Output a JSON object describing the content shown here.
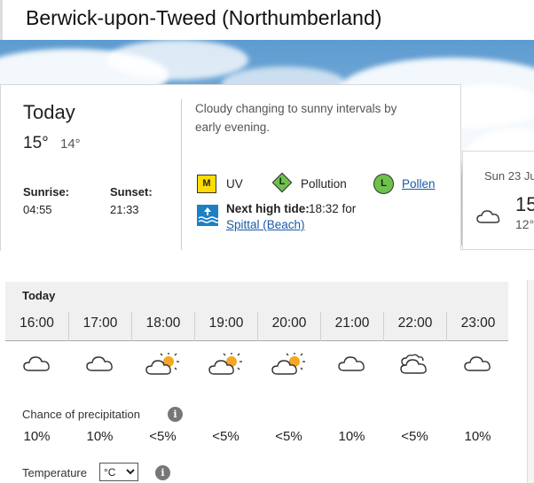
{
  "location": {
    "title": "Berwick-upon-Tweed (Northumberland)"
  },
  "today": {
    "label": "Today",
    "high": "15°",
    "low": "14°",
    "sunrise_label": "Sunrise:",
    "sunrise": "04:55",
    "sunset_label": "Sunset:",
    "sunset": "21:33",
    "summary": "Cloudy changing to sunny intervals by early evening.",
    "uv": {
      "level": "M",
      "label": "UV",
      "color": "#ffdd00"
    },
    "pollution": {
      "level": "L",
      "label": "Pollution",
      "color": "#6cc24a"
    },
    "pollen": {
      "level": "L",
      "label": "Pollen",
      "color": "#6cc24a"
    },
    "tide": {
      "label": "Next high tide:",
      "time_text": "18:32 for",
      "location": "Spittal (Beach)"
    }
  },
  "next_day": {
    "date": "Sun 23 Ju",
    "high": "15",
    "low": "12°"
  },
  "hourly": {
    "title": "Today",
    "hours": [
      {
        "time": "16:00",
        "icon": "cloud-icon",
        "precip": "10%"
      },
      {
        "time": "17:00",
        "icon": "cloud-icon",
        "precip": "10%"
      },
      {
        "time": "18:00",
        "icon": "sun-cloud-icon",
        "precip": "<5%"
      },
      {
        "time": "19:00",
        "icon": "sun-cloud-icon",
        "precip": "<5%"
      },
      {
        "time": "20:00",
        "icon": "sun-cloud-icon",
        "precip": "<5%"
      },
      {
        "time": "21:00",
        "icon": "cloud-icon",
        "precip": "10%"
      },
      {
        "time": "22:00",
        "icon": "thick-cloud-icon",
        "precip": "<5%"
      },
      {
        "time": "23:00",
        "icon": "cloud-icon",
        "precip": "10%"
      }
    ],
    "precip_label": "Chance of precipitation",
    "temp_label": "Temperature",
    "unit_selected": "°C"
  },
  "colors": {
    "link": "#1a5aa8",
    "sun": "#f5a623",
    "tide": "#1d7fc4"
  }
}
